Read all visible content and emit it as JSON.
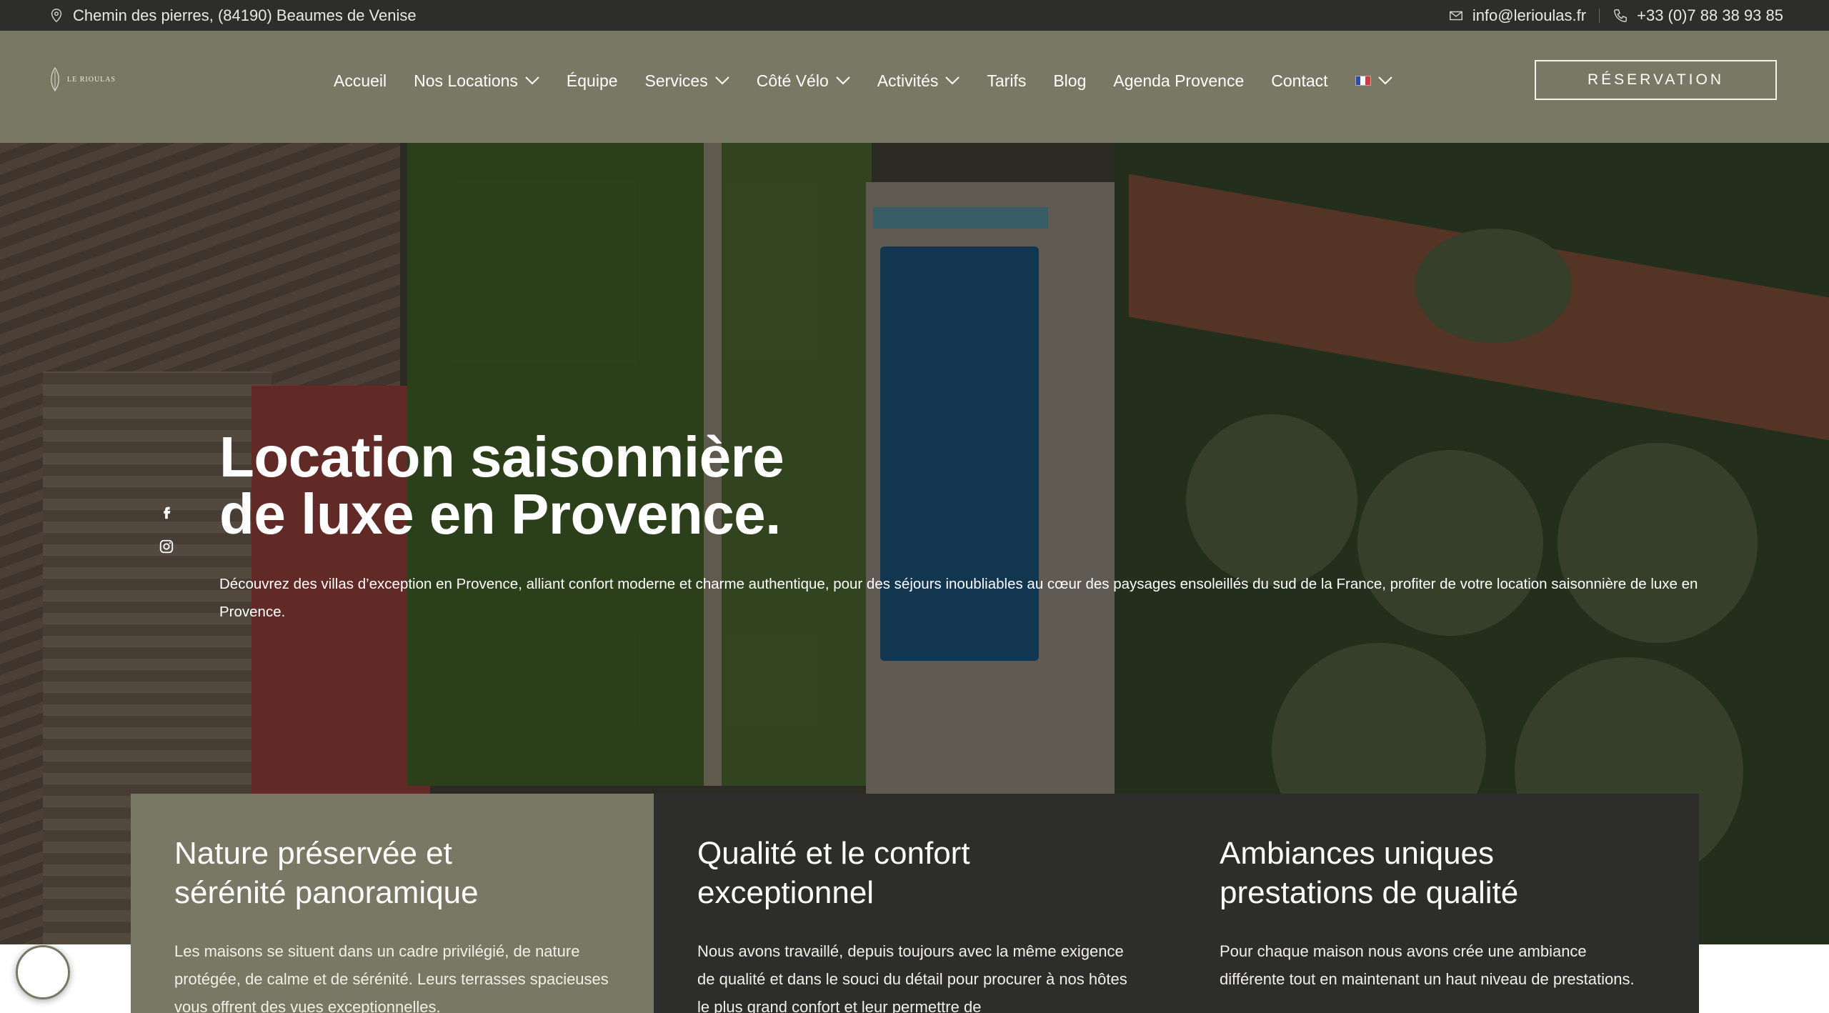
{
  "topbar": {
    "address": "Chemin des pierres, (84190) Beaumes de Venise",
    "email": "info@lerioulas.fr",
    "phone": "+33 (0)7 88 38 93 85",
    "icons": [
      "map-pin-icon",
      "mail-icon",
      "phone-icon"
    ]
  },
  "header": {
    "logo_text": "LE RIOULAS",
    "nav": [
      {
        "label": "Accueil",
        "dropdown": false
      },
      {
        "label": "Nos Locations",
        "dropdown": true
      },
      {
        "label": "Équipe",
        "dropdown": false
      },
      {
        "label": "Services",
        "dropdown": true
      },
      {
        "label": "Côté Vélo",
        "dropdown": true
      },
      {
        "label": "Activités",
        "dropdown": true
      },
      {
        "label": "Tarifs",
        "dropdown": false
      },
      {
        "label": "Blog",
        "dropdown": false
      },
      {
        "label": "Agenda Provence",
        "dropdown": false
      },
      {
        "label": "Contact",
        "dropdown": false
      }
    ],
    "language_icon": "french-flag-icon",
    "reservation_label": "RÉSERVATION"
  },
  "hero": {
    "title_line1": "Location saisonnière",
    "title_line2": "de luxe en Provence.",
    "description": "Découvrez des villas d’exception en Provence, alliant confort moderne et charme authentique, pour des séjours inoubliables au cœur des paysages ensoleillés du sud de la France, profiter de votre location saisonnière de luxe en Provence.",
    "social_icons": [
      "facebook-icon",
      "instagram-icon"
    ]
  },
  "cards": [
    {
      "title_line1": "Nature préservée et",
      "title_line2": "sérénité panoramique",
      "text": "Les maisons se situent dans un cadre privilégié, de nature protégée, de calme et de sérénité. Leurs terrasses spacieuses vous offrent des vues exceptionnelles."
    },
    {
      "title_line1": "Qualité et le confort",
      "title_line2": "exceptionnel",
      "text": "Nous avons travaillé, depuis toujours avec la même exigence de qualité et dans le souci du détail pour procurer à nos hôtes le plus grand confort et leur permettre de"
    },
    {
      "title_line1": "Ambiances uniques",
      "title_line2": "prestations de qualité",
      "text": "Pour chaque maison nous avons crée une ambiance différente tout en maintenant un haut niveau de prestations."
    }
  ],
  "colors": {
    "olive": "#787864",
    "dark": "#2d2d2b",
    "white": "#ffffff"
  }
}
